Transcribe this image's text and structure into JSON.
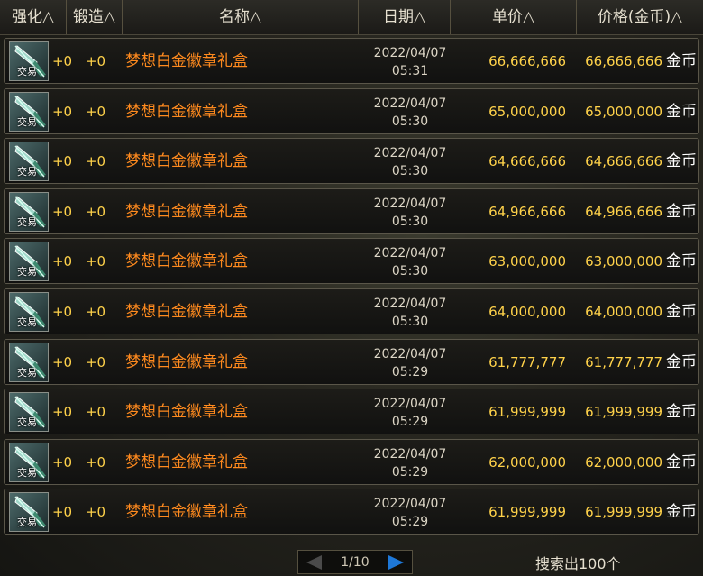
{
  "header": {
    "enhance": "强化△",
    "forge": "锻造△",
    "name": "名称△",
    "date": "日期△",
    "unit_price": "单价△",
    "price": "价格(金币)△"
  },
  "trade_tag": "交易",
  "currency": "金币",
  "listings": [
    {
      "enhance": "+0",
      "forge": "+0",
      "name": "梦想白金徽章礼盒",
      "date": "2022/04/07",
      "time": "05:31",
      "unit_price": "66,666,666",
      "price": "66,666,666"
    },
    {
      "enhance": "+0",
      "forge": "+0",
      "name": "梦想白金徽章礼盒",
      "date": "2022/04/07",
      "time": "05:30",
      "unit_price": "65,000,000",
      "price": "65,000,000"
    },
    {
      "enhance": "+0",
      "forge": "+0",
      "name": "梦想白金徽章礼盒",
      "date": "2022/04/07",
      "time": "05:30",
      "unit_price": "64,666,666",
      "price": "64,666,666"
    },
    {
      "enhance": "+0",
      "forge": "+0",
      "name": "梦想白金徽章礼盒",
      "date": "2022/04/07",
      "time": "05:30",
      "unit_price": "64,966,666",
      "price": "64,966,666"
    },
    {
      "enhance": "+0",
      "forge": "+0",
      "name": "梦想白金徽章礼盒",
      "date": "2022/04/07",
      "time": "05:30",
      "unit_price": "63,000,000",
      "price": "63,000,000"
    },
    {
      "enhance": "+0",
      "forge": "+0",
      "name": "梦想白金徽章礼盒",
      "date": "2022/04/07",
      "time": "05:30",
      "unit_price": "64,000,000",
      "price": "64,000,000"
    },
    {
      "enhance": "+0",
      "forge": "+0",
      "name": "梦想白金徽章礼盒",
      "date": "2022/04/07",
      "time": "05:29",
      "unit_price": "61,777,777",
      "price": "61,777,777"
    },
    {
      "enhance": "+0",
      "forge": "+0",
      "name": "梦想白金徽章礼盒",
      "date": "2022/04/07",
      "time": "05:29",
      "unit_price": "61,999,999",
      "price": "61,999,999"
    },
    {
      "enhance": "+0",
      "forge": "+0",
      "name": "梦想白金徽章礼盒",
      "date": "2022/04/07",
      "time": "05:29",
      "unit_price": "62,000,000",
      "price": "62,000,000"
    },
    {
      "enhance": "+0",
      "forge": "+0",
      "name": "梦想白金徽章礼盒",
      "date": "2022/04/07",
      "time": "05:29",
      "unit_price": "61,999,999",
      "price": "61,999,999"
    }
  ],
  "pagination": {
    "page_text": "1/10",
    "prev_icon": "prev-arrow-icon",
    "next_icon": "next-arrow-icon"
  },
  "search_result": "搜索出100个",
  "colors": {
    "item_name": "#ff8a1e",
    "price": "#ffd24a",
    "next_arrow": "#1e78d8",
    "prev_arrow": "#4a4a4a"
  }
}
